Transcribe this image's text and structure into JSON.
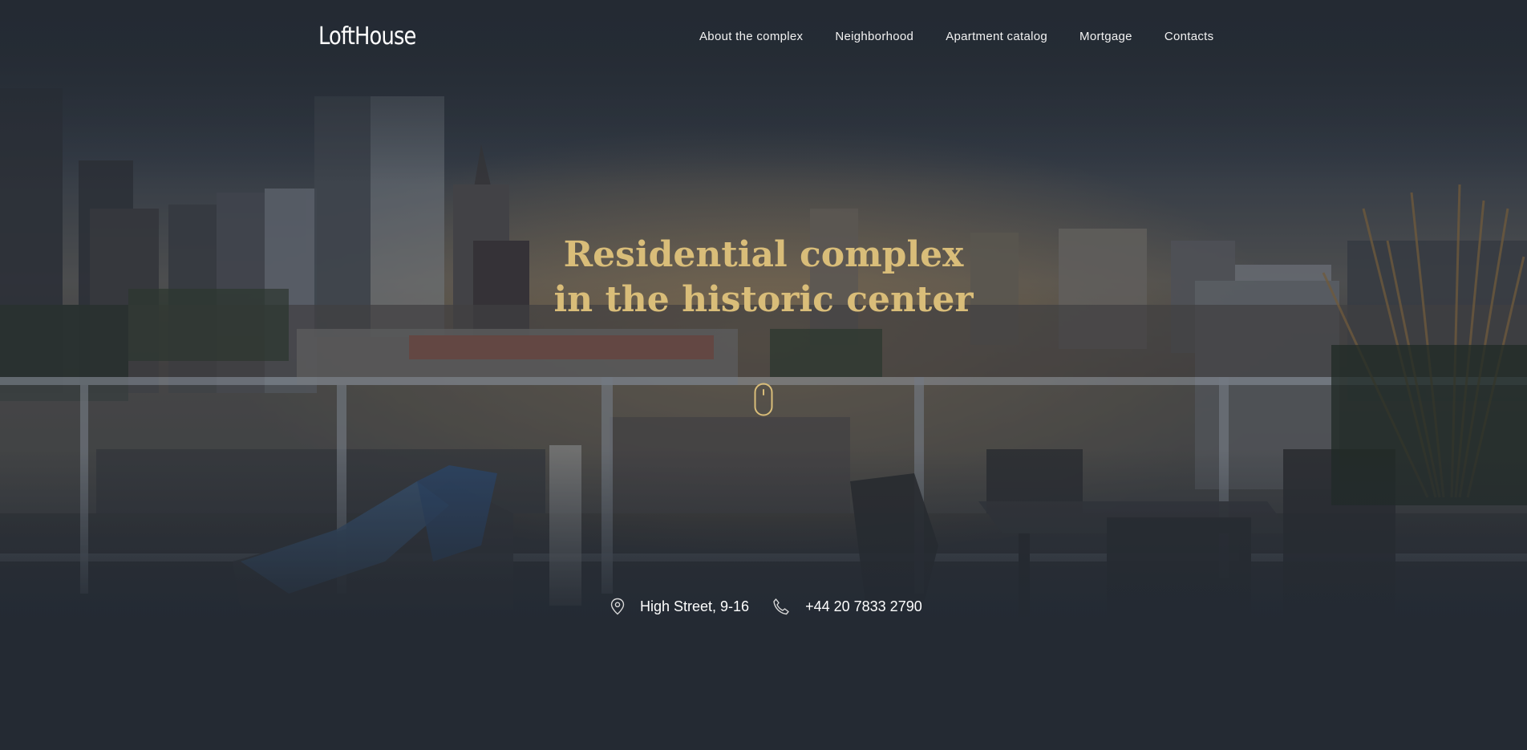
{
  "brand": {
    "logo": "LoftHouse"
  },
  "nav": {
    "items": [
      {
        "label": "About the complex"
      },
      {
        "label": "Neighborhood"
      },
      {
        "label": "Apartment catalog"
      },
      {
        "label": "Mortgage"
      },
      {
        "label": "Contacts"
      }
    ]
  },
  "hero": {
    "title_line1": "Residential complex",
    "title_line2": "in the historic center",
    "scroll_icon": "mouse-scroll-icon",
    "image": "rooftop-terrace-city-view"
  },
  "contacts": {
    "address": {
      "icon": "map-pin-icon",
      "text": "High Street, 9-16"
    },
    "phone": {
      "icon": "phone-icon",
      "text": "+44 20 7833 2790"
    }
  },
  "colors": {
    "background": "#242a33",
    "accent": "#d9bd79",
    "text": "#ffffff"
  }
}
